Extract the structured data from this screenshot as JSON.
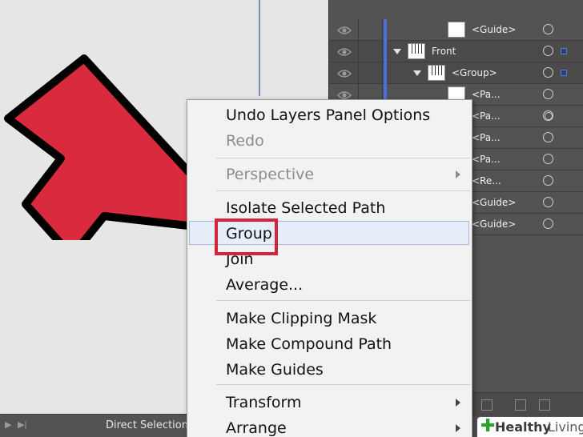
{
  "statusbar": {
    "tool_label": "Direct Selection"
  },
  "layers_panel": {
    "rows": [
      {
        "label": "<Guide>",
        "indent": 2,
        "thumb": "plain",
        "has_triangle": false,
        "selected_square": false
      },
      {
        "label": "Front",
        "indent": 0,
        "thumb": "piano",
        "has_triangle": true,
        "selected_square": true
      },
      {
        "label": "<Group>",
        "indent": 1,
        "thumb": "piano",
        "has_triangle": true,
        "selected_square": true
      },
      {
        "label": "<Pa...",
        "indent": 2,
        "thumb": "plain",
        "has_triangle": false,
        "selected_square": false
      },
      {
        "label": "<Pa...",
        "indent": 2,
        "thumb": "plain",
        "has_triangle": false,
        "selected_square": false
      },
      {
        "label": "<Pa...",
        "indent": 2,
        "thumb": "plain",
        "has_triangle": false,
        "selected_square": false
      },
      {
        "label": "<Pa...",
        "indent": 2,
        "thumb": "plain",
        "has_triangle": false,
        "selected_square": false
      },
      {
        "label": "<Re...",
        "indent": 2,
        "thumb": "plain",
        "has_triangle": false,
        "selected_square": false
      },
      {
        "label": "<Guide>",
        "indent": 2,
        "thumb": "plain",
        "has_triangle": false,
        "selected_square": false
      },
      {
        "label": "<Guide>",
        "indent": 2,
        "thumb": "plain",
        "has_triangle": false,
        "selected_square": false
      }
    ]
  },
  "context_menu": {
    "items": [
      {
        "label": "Undo Layers Panel Options",
        "disabled": false,
        "submenu": false
      },
      {
        "label": "Redo",
        "disabled": true,
        "submenu": false
      },
      {
        "label": "Perspective",
        "disabled": true,
        "submenu": true
      },
      {
        "label": "Isolate Selected Path",
        "disabled": false,
        "submenu": false
      },
      {
        "label": "Group",
        "disabled": false,
        "submenu": false,
        "hovered": true
      },
      {
        "label": "Join",
        "disabled": false,
        "submenu": false
      },
      {
        "label": "Average...",
        "disabled": false,
        "submenu": false
      },
      {
        "label": "Make Clipping Mask",
        "disabled": false,
        "submenu": false
      },
      {
        "label": "Make Compound Path",
        "disabled": false,
        "submenu": false
      },
      {
        "label": "Make Guides",
        "disabled": false,
        "submenu": false
      },
      {
        "label": "Transform",
        "disabled": false,
        "submenu": true
      },
      {
        "label": "Arrange",
        "disabled": false,
        "submenu": true
      }
    ]
  },
  "watermark": {
    "brand_strong": "Healthy",
    "brand_light": "Living"
  },
  "colors": {
    "arrow_fill": "#d92b3d",
    "highlight_box": "#d4233a",
    "layer_color_bar": "#4f6fd8",
    "panel_bg": "#535353",
    "menu_bg": "#f2f2f2"
  }
}
